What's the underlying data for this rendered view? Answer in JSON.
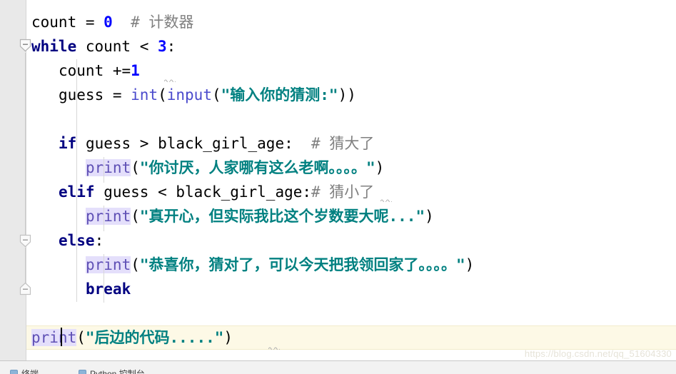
{
  "app": {
    "type": "python-code-editor",
    "language": "Python"
  },
  "colors": {
    "background": "#ffffff",
    "gutter": "#e9e9e9",
    "keyword": "#000080",
    "number": "#0000ff",
    "string": "#008080",
    "builtin": "#4a4acc",
    "comment": "#808080",
    "function_highlight_bg": "#e4dffb",
    "function_highlight_fg": "#5f50b5",
    "current_line_bg": "#fdf9e6",
    "caret": "#000000"
  },
  "code": {
    "lines": [
      {
        "n": 1,
        "indent": 0,
        "text": "count = 0  # 计数器",
        "tokens": [
          {
            "t": "count ",
            "c": "plain"
          },
          {
            "t": "= ",
            "c": "punct"
          },
          {
            "t": "0",
            "c": "num"
          },
          {
            "t": "  ",
            "c": "plain"
          },
          {
            "t": "# 计数器",
            "c": "cmt"
          }
        ]
      },
      {
        "n": 2,
        "indent": 0,
        "text": "while count < 3:",
        "tokens": [
          {
            "t": "while",
            "c": "kw"
          },
          {
            "t": " count < ",
            "c": "plain"
          },
          {
            "t": "3",
            "c": "num"
          },
          {
            "t": ":",
            "c": "punct"
          }
        ]
      },
      {
        "n": 3,
        "indent": 1,
        "text": "    count +=1",
        "tokens": [
          {
            "t": "count +=",
            "c": "plain"
          },
          {
            "t": "1",
            "c": "num"
          }
        ]
      },
      {
        "n": 4,
        "indent": 1,
        "text": "    guess = int(input(\"输入你的猜测:\"))",
        "tokens": [
          {
            "t": "guess = ",
            "c": "plain"
          },
          {
            "t": "int",
            "c": "builtin"
          },
          {
            "t": "(",
            "c": "punct"
          },
          {
            "t": "input",
            "c": "builtin"
          },
          {
            "t": "(",
            "c": "punct"
          },
          {
            "t": "\"输入你的猜测:\"",
            "c": "str"
          },
          {
            "t": "))",
            "c": "punct"
          }
        ]
      },
      {
        "n": 5,
        "indent": 0,
        "text": "",
        "tokens": []
      },
      {
        "n": 6,
        "indent": 1,
        "text": "    if guess > black_girl_age:  # 猜大了",
        "tokens": [
          {
            "t": "if",
            "c": "kw"
          },
          {
            "t": " guess > black_girl_age:",
            "c": "plain"
          },
          {
            "t": "  ",
            "c": "plain"
          },
          {
            "t": "# 猜大了",
            "c": "cmt"
          }
        ]
      },
      {
        "n": 7,
        "indent": 2,
        "text": "        print(\"你讨厌，人家哪有这么老啊。。。。\")",
        "tokens": [
          {
            "t": "print",
            "c": "fn-hl"
          },
          {
            "t": "(",
            "c": "punct"
          },
          {
            "t": "\"你讨厌，人家哪有这么老啊。。。。\"",
            "c": "str"
          },
          {
            "t": ")",
            "c": "punct"
          }
        ]
      },
      {
        "n": 8,
        "indent": 1,
        "text": "    elif guess < black_girl_age:# 猜小了",
        "tokens": [
          {
            "t": "elif",
            "c": "kw"
          },
          {
            "t": " guess < black_girl_age:",
            "c": "plain"
          },
          {
            "t": "# 猜小了",
            "c": "cmt"
          }
        ]
      },
      {
        "n": 9,
        "indent": 2,
        "text": "        print(\"真开心，但实际我比这个岁数要大呢...\")",
        "tokens": [
          {
            "t": "print",
            "c": "fn-hl"
          },
          {
            "t": "(",
            "c": "punct"
          },
          {
            "t": "\"真开心，但实际我比这个岁数要大呢...\"",
            "c": "str"
          },
          {
            "t": ")",
            "c": "punct"
          }
        ]
      },
      {
        "n": 10,
        "indent": 1,
        "text": "    else:",
        "tokens": [
          {
            "t": "else",
            "c": "kw"
          },
          {
            "t": ":",
            "c": "punct"
          }
        ]
      },
      {
        "n": 11,
        "indent": 2,
        "text": "        print(\"恭喜你，猜对了，可以今天把我领回家了。。。。\")",
        "tokens": [
          {
            "t": "print",
            "c": "fn-hl"
          },
          {
            "t": "(",
            "c": "punct"
          },
          {
            "t": "\"恭喜你，猜对了，可以今天把我领回家了。。。。\"",
            "c": "str"
          },
          {
            "t": ")",
            "c": "punct"
          }
        ]
      },
      {
        "n": 12,
        "indent": 2,
        "text": "        break",
        "tokens": [
          {
            "t": "break",
            "c": "kw"
          }
        ]
      },
      {
        "n": 13,
        "indent": 0,
        "text": "",
        "tokens": []
      },
      {
        "n": 14,
        "indent": 0,
        "current": true,
        "text": "print(\"后边的代码.....\")",
        "tokens": [
          {
            "t": "print",
            "c": "fn-hl"
          },
          {
            "t": "(",
            "c": "punct"
          },
          {
            "t": "\"后边的代码.....\"",
            "c": "str"
          },
          {
            "t": ")",
            "c": "punct"
          }
        ]
      }
    ]
  },
  "fold_markers": [
    {
      "name": "fold-while-block",
      "collapsed": false,
      "shape": "pentagon-down"
    },
    {
      "name": "fold-else-block",
      "collapsed": false,
      "shape": "pentagon-down"
    },
    {
      "name": "fold-block-end",
      "collapsed": false,
      "shape": "pentagon-up"
    }
  ],
  "caret": {
    "line": 14,
    "after_text": "pri",
    "column": 4
  },
  "warnings": [
    {
      "name": "pep8-missing-whitespace-around-operator",
      "line": 3,
      "target": "1"
    },
    {
      "name": "pep8-inline-comment-spacing",
      "line": 8,
      "target": ":"
    },
    {
      "name": "pep8-trailing",
      "line": 14,
      "target": ")"
    }
  ],
  "watermark": {
    "text": "https://blog.csdn.net/qq_51604330"
  },
  "tool_window_bar": {
    "items": [
      {
        "label": "终端",
        "icon": "terminal-icon"
      },
      {
        "label": "Python 控制台",
        "icon": "python-console-icon"
      }
    ]
  }
}
